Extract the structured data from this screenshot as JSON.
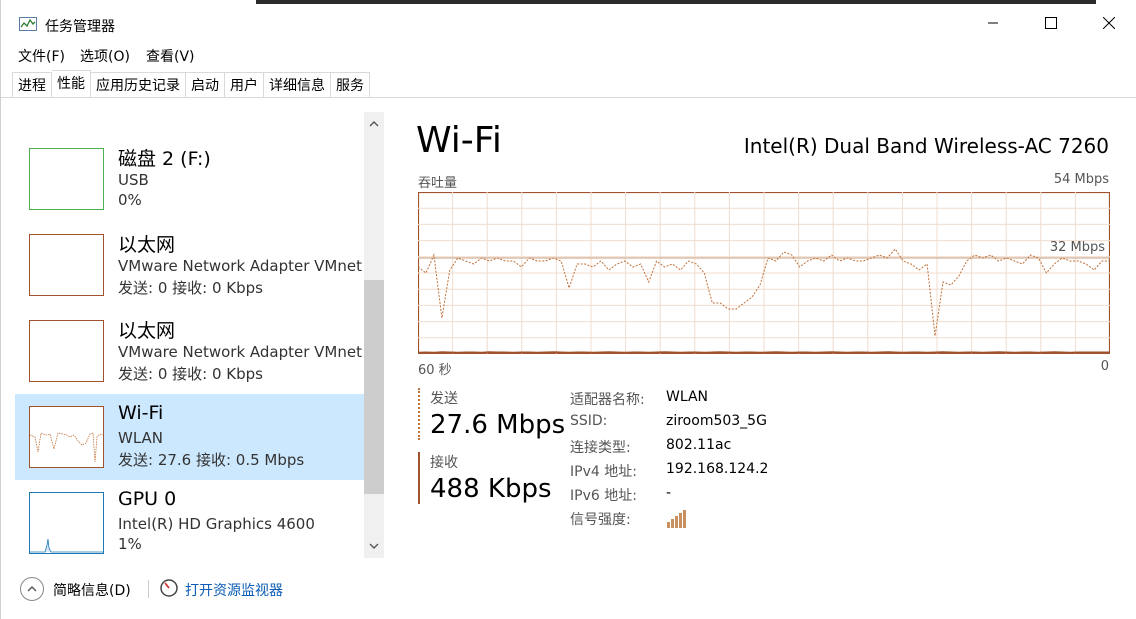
{
  "window": {
    "title": "任务管理器"
  },
  "menu": [
    "文件(F)",
    "选项(O)",
    "查看(V)"
  ],
  "tabs": [
    {
      "label": "进程"
    },
    {
      "label": "性能",
      "active": true
    },
    {
      "label": "应用历史记录"
    },
    {
      "label": "启动"
    },
    {
      "label": "用户"
    },
    {
      "label": "详细信息"
    },
    {
      "label": "服务"
    }
  ],
  "sidebar": {
    "partial_value": "0%",
    "items": [
      {
        "name": "磁盘 2 (F:)",
        "sub": "USB",
        "value": "0%",
        "color": "#4caf50"
      },
      {
        "name": "以太网",
        "sub": "VMware Network Adapter VMnet",
        "value": "发送: 0 接收: 0 Kbps",
        "color": "#a0522d"
      },
      {
        "name": "以太网",
        "sub": "VMware Network Adapter VMnet",
        "value": "发送: 0 接收: 0 Kbps",
        "color": "#a0522d"
      },
      {
        "name": "Wi-Fi",
        "sub": "WLAN",
        "value": "发送: 27.6 接收: 0.5 Mbps",
        "color": "#a0522d",
        "selected": true
      },
      {
        "name": "GPU 0",
        "sub": "Intel(R) HD Graphics 4600",
        "value": "1%",
        "color": "#1e78b4"
      }
    ]
  },
  "main": {
    "title": "Wi-Fi",
    "adapter": "Intel(R) Dual Band Wireless-AC 7260",
    "chart_label": "吞吐量",
    "max_label": "54 Mbps",
    "mid_label": "32 Mbps",
    "time_label": "60 秒",
    "zero_label": "0"
  },
  "stats": {
    "send_label": "发送",
    "send_value": "27.6 Mbps",
    "recv_label": "接收",
    "recv_value": "488 Kbps"
  },
  "properties": [
    {
      "key": "适配器名称:",
      "value": "WLAN"
    },
    {
      "key": "SSID:",
      "value": "ziroom503_5G"
    },
    {
      "key": "连接类型:",
      "value": "802.11ac"
    },
    {
      "key": "IPv4 地址:",
      "value": "192.168.124.2"
    },
    {
      "key": "IPv6 地址:",
      "value": "-"
    },
    {
      "key": "信号强度:",
      "value": ""
    }
  ],
  "footer": {
    "collapse_label": "简略信息(D)",
    "monitor_label": "打开资源监视器"
  },
  "chart_data": {
    "type": "line",
    "ylim": [
      0,
      54
    ],
    "series": [
      {
        "color": "#c0703a",
        "style": "dotted",
        "values": [
          29,
          27,
          33,
          12,
          28,
          32,
          31,
          30,
          32,
          31,
          32,
          31,
          31,
          29,
          32,
          31,
          31,
          32,
          31,
          22,
          30,
          30,
          29,
          31,
          28,
          30,
          31,
          29,
          30,
          24,
          31,
          29,
          30,
          28,
          31,
          30,
          27,
          17,
          17,
          15,
          15,
          17,
          19,
          23,
          32,
          31,
          34,
          33,
          29,
          31,
          32,
          31,
          33,
          31,
          32,
          31,
          31,
          32,
          33,
          32,
          35,
          31,
          30,
          28,
          30,
          6,
          24,
          23,
          26,
          31,
          33,
          32,
          33,
          31,
          32,
          31,
          30,
          33,
          32,
          27,
          30,
          32,
          31,
          31,
          30,
          28,
          31,
          31
        ]
      },
      {
        "color": "#a0522d",
        "style": "solid",
        "values": [
          0.4,
          0.5,
          0.4,
          0.6,
          0.5,
          0.4,
          0.5,
          0.5,
          0.4,
          0.6,
          0.5,
          0.5,
          0.4,
          0.5,
          0.5,
          0.4,
          0.5,
          0.6,
          0.5,
          0.4,
          0.5,
          0.5,
          0.4,
          0.5,
          0.6,
          0.5,
          0.4,
          0.5,
          0.5,
          0.4,
          0.5,
          0.6,
          0.5,
          0.4,
          0.5,
          0.5,
          0.4,
          0.5,
          0.6,
          0.5,
          0.4,
          0.5,
          0.5,
          0.4,
          0.5,
          0.6,
          0.5,
          0.4,
          0.5,
          0.5,
          0.4,
          0.5,
          0.6,
          0.5,
          0.4,
          0.5,
          0.5,
          0.4,
          0.5,
          0.6,
          0.5,
          0.4,
          0.5,
          0.5,
          0.4,
          0.5,
          0.6,
          0.5,
          0.4,
          0.5,
          0.5,
          0.4,
          0.5,
          0.6,
          0.5,
          0.4,
          0.5,
          0.5,
          0.4,
          0.5,
          0.6,
          0.5,
          0.4,
          0.5,
          0.5,
          0.5,
          0.5,
          0.5
        ]
      }
    ]
  }
}
